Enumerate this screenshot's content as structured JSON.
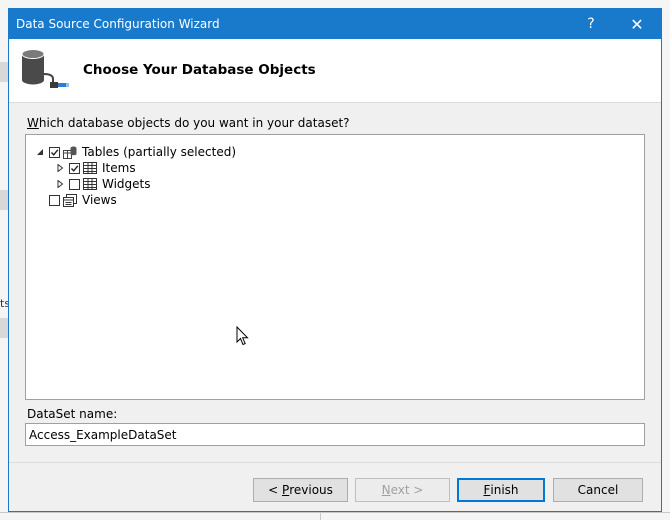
{
  "window": {
    "title": "Data Source Configuration Wizard",
    "help_glyph": "?",
    "close_glyph": "✕"
  },
  "header": {
    "title": "Choose Your Database Objects",
    "icon": "database-connect-icon"
  },
  "prompt": {
    "accesskey": "W",
    "rest": "hich database objects do you want in your dataset?"
  },
  "tree": {
    "tables": {
      "label": "Tables (partially selected)",
      "state": "partial",
      "expanded": true
    },
    "items": {
      "label": "Items",
      "checked": true,
      "expanded": false
    },
    "widgets": {
      "label": "Widgets",
      "checked": false,
      "expanded": false
    },
    "views": {
      "label": "Views",
      "checked": false
    }
  },
  "dataset": {
    "label": "DataSet name:",
    "value": "Access_ExampleDataSet"
  },
  "buttons": {
    "previous": {
      "prefix": "< ",
      "accesskey": "P",
      "rest": "revious",
      "enabled": true
    },
    "next": {
      "accesskey": "N",
      "rest": "ext >",
      "enabled": false
    },
    "finish": {
      "accesskey": "F",
      "rest": "inish",
      "default": true
    },
    "cancel": {
      "label": "Cancel"
    }
  },
  "colors": {
    "titlebar": "#1979ca",
    "dialog_bg": "#f0f0f0",
    "focus_border": "#0078d7"
  }
}
